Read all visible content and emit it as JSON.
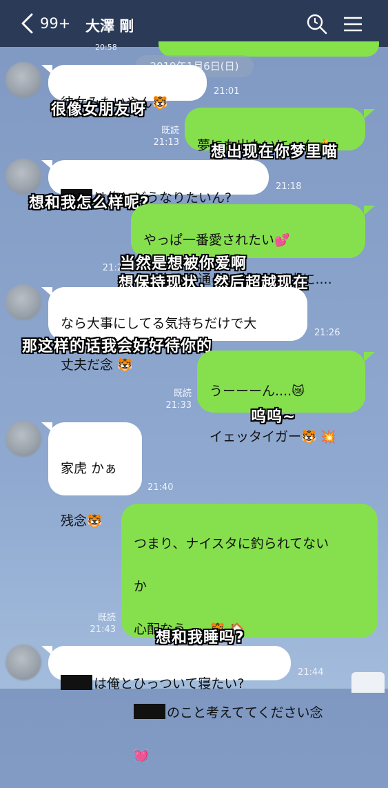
{
  "header": {
    "unread_count": "99+",
    "contact_name": "大澤 剛",
    "icons": [
      "back-chevron-icon",
      "search-icon",
      "menu-icon"
    ]
  },
  "partial_time_top": "20:58",
  "date_separator": "2019年1月6日(日)",
  "messages": [
    {
      "side": "left",
      "text": "彼女みたいやん",
      "emoji": "🐯",
      "time": "21:01",
      "subtitle": "很像女朋友呀"
    },
    {
      "side": "right",
      "text": "夢にも出たいにゃん",
      "emoji": "🐈",
      "read": "既読",
      "time": "21:13",
      "subtitle": "想出现在你梦里喵"
    },
    {
      "side": "left",
      "text": "は俺とどうなりたいん?",
      "time": "21:18",
      "subtitle": "想和我怎么样呢?"
    },
    {
      "side": "right",
      "line1": "やっぱ一番愛されたい",
      "line1_emoji": "💕",
      "line2": "(((今まで通り、今まで以上に....",
      "read": "既読",
      "time": "21:2",
      "subtitle1": "当然是想被你爱啊",
      "subtitle2": "想保持现状，然后超越现在"
    },
    {
      "side": "left",
      "line1": "なら大事にしてる気持ちだけで大",
      "line2": "丈夫だ念",
      "emoji": "🐯",
      "time": "21:26",
      "subtitle": "那这样的话我会好好待你的"
    },
    {
      "side": "right",
      "line1": "うーーーん....",
      "line1_emoji": "😿",
      "line2": "イェッタイガー",
      "line2_emoji": "🐯 💥",
      "read": "既読",
      "time": "21:33",
      "subtitle": "呜呜~"
    },
    {
      "side": "left",
      "line1": "家虎 かぁ",
      "line2": "残念",
      "emoji": "🐯",
      "time": "21:40"
    },
    {
      "side": "right",
      "line1": "つまり、ナイスタに釣られてない",
      "line2": "か",
      "line3": "心配なう、、",
      "line3_emoji": "🐯 🏠",
      "line4": "のこと考えててください念",
      "line5_emoji": "💓",
      "read": "既読",
      "time": "21:43",
      "subtitle": "想和我睡吗?"
    },
    {
      "side": "left",
      "text": "は俺とひっついて寝たい?",
      "time": "21:44"
    }
  ],
  "colors": {
    "header": "#2b3a57",
    "green_bubble": "#86e04d",
    "white_bubble": "#ffffff"
  }
}
